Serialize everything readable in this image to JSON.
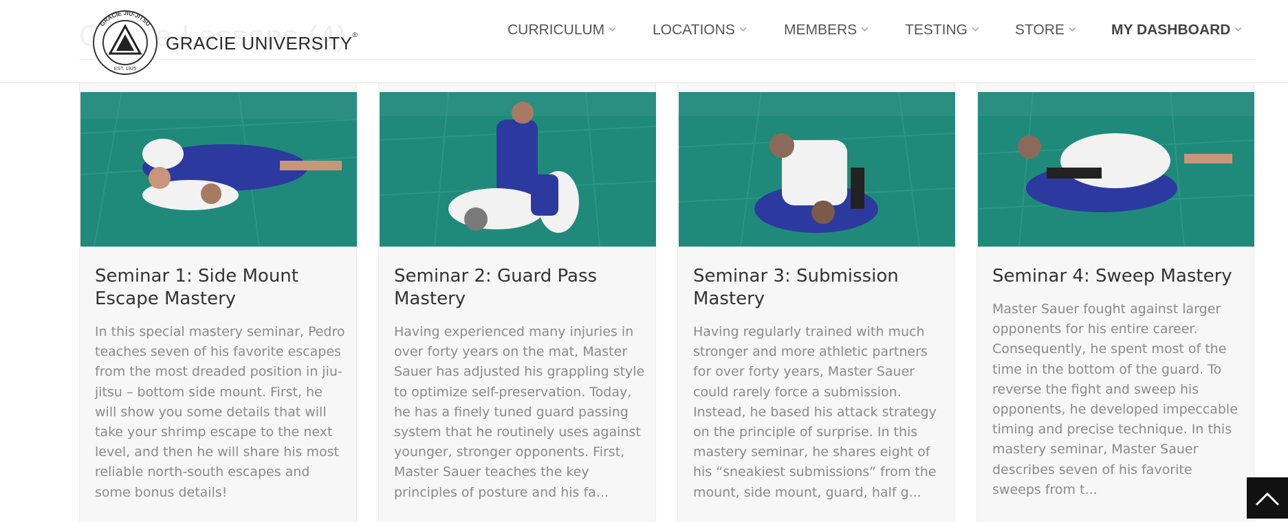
{
  "header": {
    "ghost_title": "Gracie Lessons (4)",
    "logo": {
      "seal_top_text": "GRACIE JIU-JITSU",
      "seal_bottom_text": "EST. 1925",
      "brand_name": "GRACIE UNIVERSITY",
      "registered_mark": "®"
    },
    "nav": [
      {
        "label": "CURRICULUM",
        "icon": "chevron-down-icon"
      },
      {
        "label": "LOCATIONS",
        "icon": "chevron-down-icon"
      },
      {
        "label": "MEMBERS",
        "icon": "chevron-down-icon"
      },
      {
        "label": "TESTING",
        "icon": "chevron-down-icon"
      },
      {
        "label": "STORE",
        "icon": "chevron-down-icon"
      },
      {
        "label": "MY DASHBOARD",
        "icon": "chevron-down-icon"
      }
    ]
  },
  "cards": [
    {
      "title": "Seminar 1: Side Mount Escape Mastery",
      "description": "In this special mastery seminar, Pedro teaches seven of his favorite escapes from the most dreaded position in jiu-jitsu – bottom side mount. First, he will show you some details that will take your shrimp escape to the next level, and then he will share his most reliable north-south escapes and some bonus details!"
    },
    {
      "title": "Seminar 2: Guard Pass Mastery",
      "description": "Having experienced many injuries in over forty years on the mat, Master Sauer has adjusted his grappling style to optimize self-preservation. Today, he has a finely tuned guard passing system that he routinely uses against younger, stronger opponents. First, Master Sauer teaches the key principles of posture and his fa..."
    },
    {
      "title": "Seminar 3: Submission Mastery",
      "description": "Having regularly trained with much stronger and more athletic partners for over forty years, Master Sauer could rarely force a submission. Instead, he based his attack strategy on the principle of surprise. In this mastery seminar, he shares eight of his “sneakiest submissions” from the mount, side mount, guard, half g..."
    },
    {
      "title": "Seminar 4: Sweep Mastery",
      "description": "Master Sauer fought against larger opponents for his entire career. Consequently, he spent most of the time in the bottom of the guard. To reverse the fight and sweep his opponents, he developed impeccable timing and precise technique. In this mastery seminar, Master Sauer describes seven of his favorite sweeps from t..."
    }
  ],
  "colors": {
    "mat_green": "#1f8a7a",
    "gi_blue": "#2c3aa0",
    "gi_white": "#f2f2f2",
    "card_bg": "#f7f7f7",
    "text_gray": "#8a8a8a"
  },
  "back_to_top_icon": "chevron-up-icon"
}
